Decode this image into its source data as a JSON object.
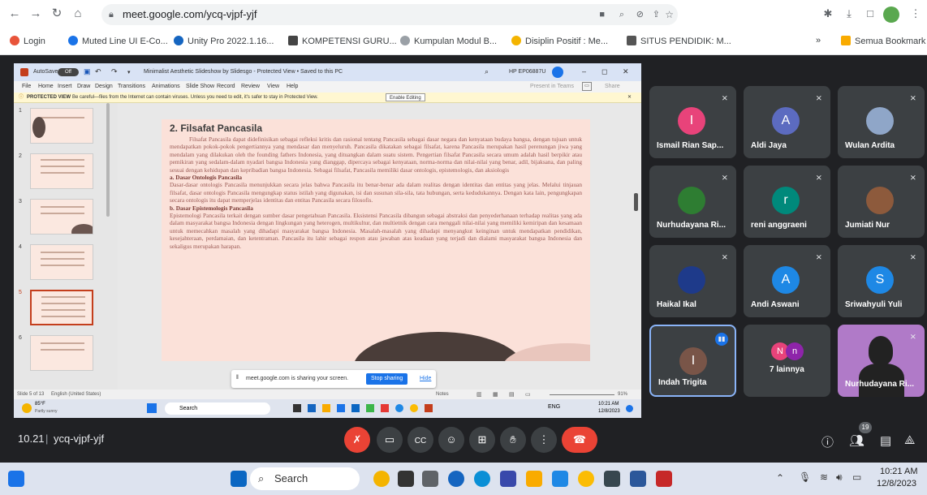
{
  "browser": {
    "url": "meet.google.com/ycq-vjpf-yjf",
    "bookmarks": [
      "Login",
      "Muted Line UI E-Co...",
      "Unity Pro 2022.1.16...",
      "KOMPETENSI GURU...",
      "Kumpulan Modul B...",
      "Disiplin Positif : Me...",
      "SITUS PENDIDIK: M..."
    ],
    "more_label": "»",
    "all_bookmarks": "Semua Bookmark"
  },
  "powerpoint": {
    "autosave": "AutoSave",
    "autosave_state": "Off",
    "title": "Minimalist Aesthetic Slideshow by Slidesgo - Protected View • Saved to this PC",
    "account": "HP EP06887U",
    "menu": [
      "File",
      "Home",
      "Insert",
      "Draw",
      "Design",
      "Transitions",
      "Animations",
      "Slide Show",
      "Record",
      "Review",
      "View",
      "Help"
    ],
    "present_teams": "Present in Teams",
    "share_label": "Share",
    "protected_label": "PROTECTED VIEW",
    "protected_msg": "Be careful—files from the Internet can contain viruses. Unless you need to edit, it's safer to stay in Protected View.",
    "enable_editing": "Enable Editing",
    "thumb_numbers": [
      "1",
      "2",
      "3",
      "4",
      "5",
      "6"
    ],
    "status_slide": "Slide 5 of 13",
    "status_lang": "English (United States)",
    "notes": "Notes",
    "zoom": "91%",
    "slide": {
      "title": "2. Filsafat Pancasila",
      "para1": "Filsafat Pancasila dapat didefinisikan sebagai refleksi kritis dan rasional tentang Pancasila sebagai dasar negara dan kenyataan budaya bangsa, dengan tujuan untuk mendapatkan pokok-pokok pengertiannya yang mendasar dan menyeluruh. Pancasila dikatakan sebagai filsafat, karena Pancasila merupakan hasil perenungan jiwa yang mendalam yang dilakukan oleh the founding fathers Indonesia, yang dituangkan dalam suatu sistem. Pengertian filsafat Pancasila secara umum adalah hasil berpikir atau pemikiran yang sedalam-dalam nyadari bangsa Indonesia yang dianggap, dipercaya sebagai kenyataan, norma-norma dan nilai-nilai yang benar, adil, bijaksana, dan paling sesuai dengan kehidupan dan kepribadian bangsa Indonesia. Sebagai filsafat, Pancasila memiliki dasar ontologis, epistemologis, dan aksiologis",
      "sub_a": "a. Dasar Ontologis Pancasila",
      "para2": "Dasar-dasar ontologis Pancasila menunjukkan secara jelas bahwa Pancasila itu benar-benar ada dalam realitas dengan identitas dan entitas yang jelas. Melalui tinjauan filsafat, dasar ontologis Pancasila mengungkap status istilah yang digunakan, isi dan susunan sila-sila, tata hubungan, serta kedudukannya. Dengan kata lain, pengungkapan secara ontologis itu dapat memperjelas identitas dan entitas Pancasila secara filosofis.",
      "sub_b": "b. Dasar Epistemologis Pancasila",
      "para3": "Epistemologi Pancasila terkait dengan sumber dasar pengetahuan Pancasila. Eksistensi Pancasila dibangun sebagai abstraksi dan penyederhanaan terhadap realitas yang ada dalam masyarakat bangsa Indonesia dengan lingkungan yang heterogen, multikultur, dan multietnik dengan cara menggali nilai-nilai yang memiliki kemiripan dan kesamaan untuk memecahkan masalah yang dihadapi masyarakat bangsa Indonesia. Masalah-masalah yang dihadapi menyangkut keinginan untuk mendapatkan pendidikan, kesejahteraan, perdamaian, dan ketentraman. Pancasila itu lahir sebagai respon atau jawaban atas keadaan yang terjadi dan dialami masyarakat bangsa Indonesia dan sekaligus merupakan harapan."
    },
    "share_notice": "meet.google.com is sharing your screen.",
    "stop_sharing": "Stop sharing",
    "hide": "Hide",
    "inner_taskbar": {
      "weather_temp": "85°F",
      "weather_desc": "Partly sunny",
      "search": "Search",
      "lang": "ENG",
      "time": "10:21 AM",
      "date": "12/8/2023"
    }
  },
  "participants": [
    {
      "name": "Ismail Rian Sap...",
      "initial": "I",
      "color": "#e8437a",
      "type": "initial"
    },
    {
      "name": "Aldi Jaya",
      "initial": "A",
      "color": "#5c6bc0",
      "type": "initial"
    },
    {
      "name": "Wulan Ardita",
      "initial": "",
      "color": "#8fa6c8",
      "type": "photo"
    },
    {
      "name": "Nurhudayana Ri...",
      "initial": "",
      "color": "#2e7d32",
      "type": "photo"
    },
    {
      "name": "reni anggraeni",
      "initial": "r",
      "color": "#00897b",
      "type": "initial"
    },
    {
      "name": "Jumiati Nur",
      "initial": "",
      "color": "#8d5a3c",
      "type": "photo"
    },
    {
      "name": "Haikal Ikal",
      "initial": "",
      "color": "#1e3a8a",
      "type": "photo"
    },
    {
      "name": "Andi Aswani",
      "initial": "A",
      "color": "#1e88e5",
      "type": "initial"
    },
    {
      "name": "Sriwahyuli Yuli",
      "initial": "S",
      "color": "#1e88e5",
      "type": "initial"
    },
    {
      "name": "Indah Trigita",
      "initial": "I",
      "color": "#795548",
      "type": "initial"
    },
    {
      "name": "7 lainnya",
      "initial": "N",
      "initial2": "n",
      "color": "#e8437a",
      "color2": "#8e24aa",
      "type": "others"
    },
    {
      "name": "Nurhudayana Ri...",
      "initial": "",
      "color": "#b07ac8",
      "type": "video"
    }
  ],
  "meet": {
    "time": "10.21",
    "separator": "|",
    "code": "ycq-vjpf-yjf",
    "participant_count": "19"
  },
  "taskbar": {
    "search": "Search",
    "time": "10:21 AM",
    "date": "12/8/2023"
  },
  "colors": {
    "end_call": "#ea4335",
    "mic_off": "#ea4335",
    "meet_bg": "#202124",
    "tile_bg": "#3c4043"
  }
}
